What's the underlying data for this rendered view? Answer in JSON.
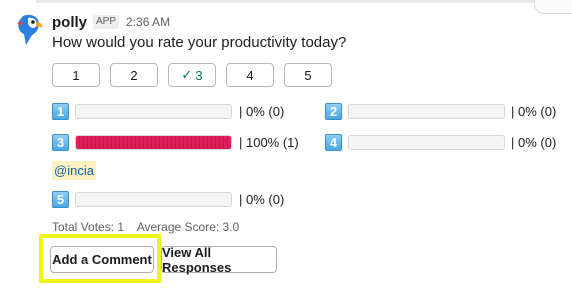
{
  "message": {
    "app_name": "polly",
    "app_badge": "APP",
    "timestamp": "2:36 AM",
    "question": "How would you rate your productivity today?"
  },
  "rating_buttons": [
    {
      "label": "1",
      "selected": false
    },
    {
      "label": "2",
      "selected": false
    },
    {
      "label": "3",
      "selected": true,
      "check": "✓"
    },
    {
      "label": "4",
      "selected": false
    },
    {
      "label": "5",
      "selected": false
    }
  ],
  "results": [
    {
      "key": "1",
      "percent": 0,
      "label": "| 0% (0)"
    },
    {
      "key": "2",
      "percent": 0,
      "label": "| 0% (0)"
    },
    {
      "key": "3",
      "percent": 100,
      "label": "| 100% (1)"
    },
    {
      "key": "4",
      "percent": 0,
      "label": "| 0% (0)"
    },
    {
      "key": "5",
      "percent": 0,
      "label": "| 0% (0)"
    }
  ],
  "voters_for_3": "@incia",
  "stats": {
    "total_votes": "Total Votes: 1",
    "average_score": "Average Score: 3.0"
  },
  "actions": {
    "add_comment": "Add a Comment",
    "view_all": "View All Responses"
  },
  "colors": {
    "bar_fill": "#e01e5a",
    "selected_text": "#007a5a",
    "highlight": "#ecf41a",
    "mention_bg": "#faf2c3"
  },
  "icons": {
    "avatar": "parrot-avatar-icon",
    "number_keycap": "keycap-number-icon",
    "check": "checkmark-icon"
  }
}
